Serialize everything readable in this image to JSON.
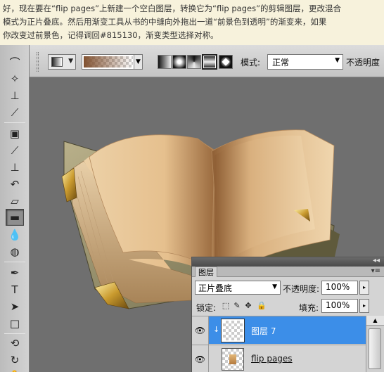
{
  "tutorial": {
    "line1": "好，现在要在“flip pages”上新建一个空白图层，转换它为“flip pages”的剪辑图层，更改混合",
    "line2": "模式为正片叠底。然后用渐变工具从书的中缝向外拖出一道“前景色到透明”的渐变来，如果",
    "line3": "你改变过前景色，记得调回#815130，渐变类型选择对称。"
  },
  "options_bar": {
    "tool_preset_icon": "gradient-tool-icon",
    "gradient_colors": [
      "#815130",
      "transparent"
    ],
    "gradient_types": [
      "linear",
      "radial",
      "angle",
      "reflected",
      "diamond"
    ],
    "selected_gradient_type": "reflected",
    "mode_label": "模式:",
    "mode_value": "正常",
    "opacity_label": "不透明度"
  },
  "toolbox": {
    "tools": [
      "lasso-icon",
      "magic-wand-icon",
      "crop-icon",
      "eyedropper-icon",
      "healing-brush-icon",
      "brush-icon",
      "clone-stamp-icon",
      "history-brush-icon",
      "eraser-icon",
      "gradient-icon",
      "blur-icon",
      "dodge-icon",
      "pen-icon",
      "type-icon",
      "path-selection-icon",
      "shape-icon",
      "3d-rotate-icon",
      "3d-orbit-icon",
      "hand-icon"
    ],
    "selected_tool": "gradient-icon"
  },
  "layers_panel": {
    "tab_label": "图层",
    "blend_mode": "正片叠底",
    "opacity_label": "不透明度:",
    "opacity_value": "100%",
    "lock_label": "锁定:",
    "fill_label": "填充:",
    "fill_value": "100%",
    "layers": [
      {
        "name": "图层 7",
        "selected": true,
        "clipped": true,
        "visible": true
      },
      {
        "name": "flip pages",
        "selected": false,
        "clipped": false,
        "visible": true
      }
    ]
  },
  "colors": {
    "selection_blue": "#3c8ee8",
    "foreground": "#815130",
    "canvas_bg": "#6f6f6f"
  }
}
